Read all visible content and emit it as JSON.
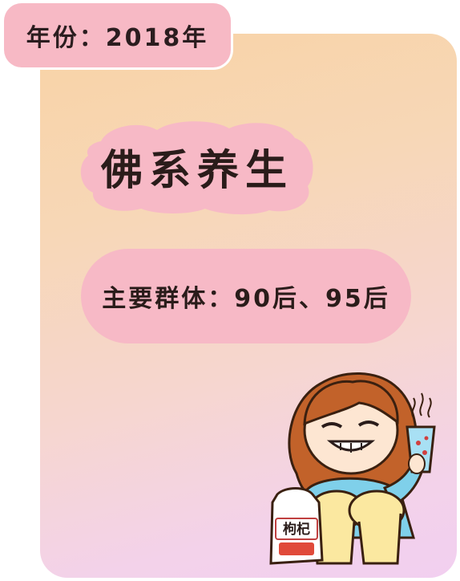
{
  "year_tag": {
    "text": "年份：2018年"
  },
  "title": {
    "text": "佛系养生"
  },
  "group": {
    "text": "主要群体：90后、95后"
  },
  "illustration": {
    "bag_label": "枸杞"
  },
  "colors": {
    "card_top": "#f8d3a6",
    "card_bottom": "#f2cff0",
    "pink": "#f7b9c5",
    "text": "#2a1c1a"
  }
}
